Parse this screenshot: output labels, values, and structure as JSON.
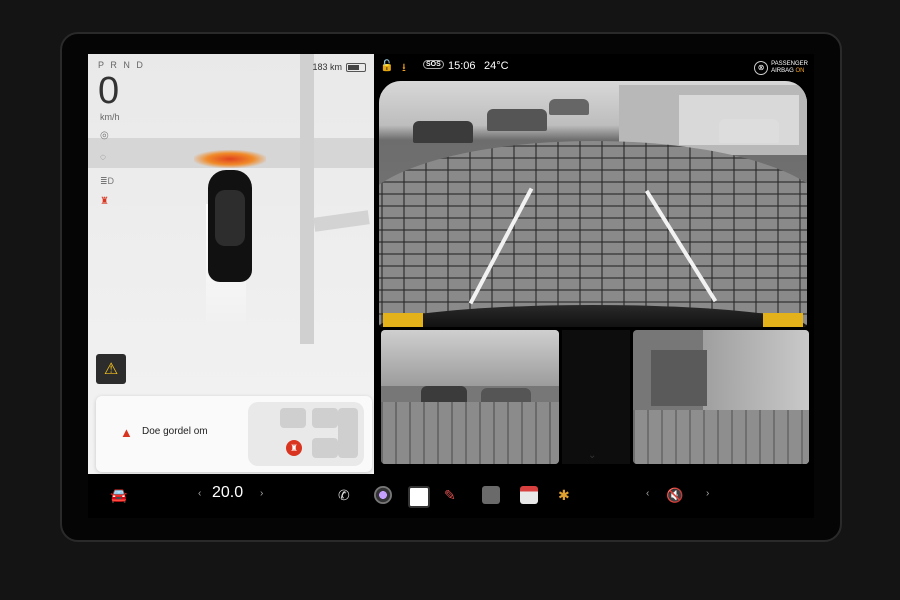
{
  "drive": {
    "gear": "P R N D",
    "speed": "0",
    "speed_unit": "km/h",
    "range": "183 km"
  },
  "alert": {
    "message": "Doe gordel om"
  },
  "status_bar": {
    "sos_label": "SOS",
    "time": "15:06",
    "temperature": "24°C",
    "airbag_line1": "PASSENGER",
    "airbag_line2": "AIRBAG",
    "airbag_state": "ON"
  },
  "bottom_bar": {
    "temperature_setting": "20.0",
    "icons": [
      "car-icon",
      "phone-icon",
      "camera-icon",
      "app-launcher-icon",
      "toybox-icon",
      "calendar-icon",
      "games-icon",
      "volume-mute-icon"
    ]
  },
  "colors": {
    "accent_orange": "#f0a020",
    "alert_red": "#d9341f",
    "warning_yellow": "#f6c21a"
  }
}
